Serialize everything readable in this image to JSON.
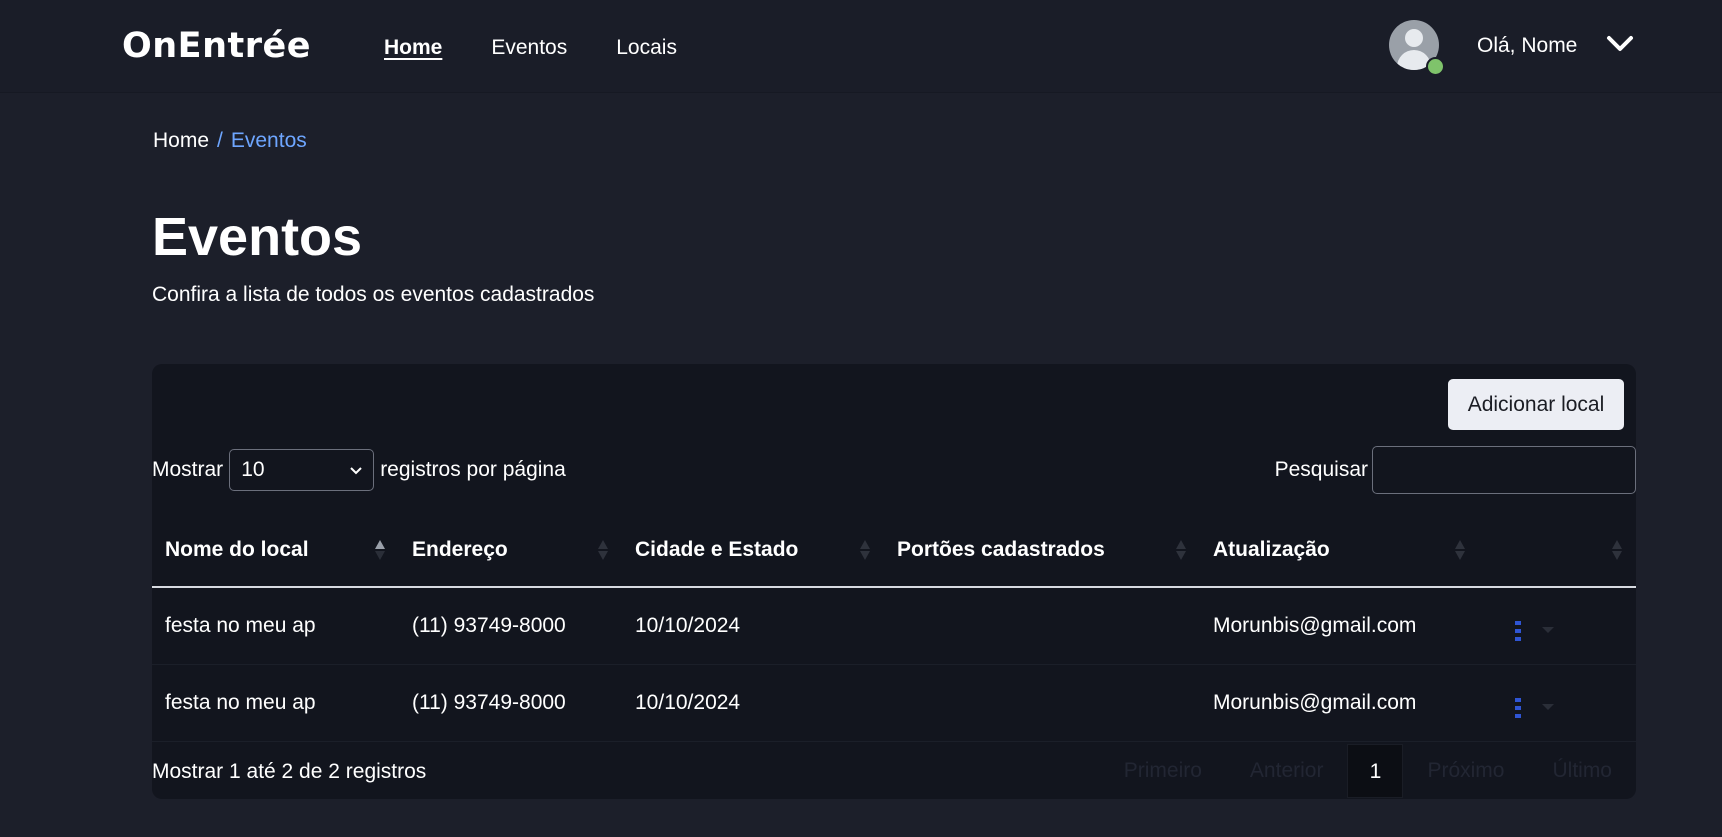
{
  "header": {
    "logo": "OnEntrée",
    "nav": [
      {
        "label": "Home",
        "active": true
      },
      {
        "label": "Eventos",
        "active": false
      },
      {
        "label": "Locais",
        "active": false
      }
    ],
    "greeting": "Olá, Nome"
  },
  "breadcrumb": {
    "root": "Home",
    "separator": "/",
    "current": "Eventos"
  },
  "page": {
    "title": "Eventos",
    "subtitle": "Confira a lista de todos os eventos cadastrados"
  },
  "toolbar": {
    "add_label": "Adicionar local",
    "show_label": "Mostrar",
    "page_size": "10",
    "per_page_label": "registros por página",
    "search_label": "Pesquisar",
    "search_value": ""
  },
  "table": {
    "columns": [
      "Nome do local",
      "Endereço",
      "Cidade e Estado",
      "Portões cadastrados",
      "Atualização",
      ""
    ],
    "rows": [
      [
        "festa no meu ap",
        "(11) 93749-8000",
        "10/10/2024",
        "",
        "Morunbis@gmail.com"
      ],
      [
        "festa no meu ap",
        "(11) 93749-8000",
        "10/10/2024",
        "",
        "Morunbis@gmail.com"
      ]
    ]
  },
  "footer": {
    "info": "Mostrar 1 até 2 de 2 registros",
    "pagination": {
      "first": "Primeiro",
      "previous": "Anterior",
      "current": "1",
      "next": "Próximo",
      "last": "Último"
    }
  },
  "colors": {
    "background": "#1c1f2a",
    "card": "#12151e",
    "accent_link": "#6ea6ff",
    "status_online": "#7fc36b",
    "action_icon": "#2f55d4"
  }
}
